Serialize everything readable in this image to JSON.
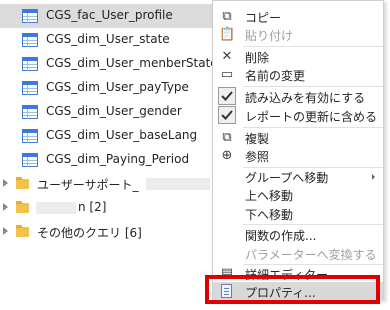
{
  "queries": [
    {
      "label": "CGS_fac_User_profile",
      "selected": true
    },
    {
      "label": "CGS_dim_User_state",
      "selected": false
    },
    {
      "label": "CGS_dim_User_menberState",
      "selected": false
    },
    {
      "label": "CGS_dim_User_payType",
      "selected": false
    },
    {
      "label": "CGS_dim_User_gender",
      "selected": false
    },
    {
      "label": "CGS_dim_User_baseLang",
      "selected": false
    },
    {
      "label": "CGS_dim_Paying_Period",
      "selected": false
    }
  ],
  "groups": [
    {
      "label": "ユーザーサポート_"
    },
    {
      "label": "n [2]"
    },
    {
      "label": "その他のクエリ [6]"
    }
  ],
  "menu": {
    "copy": "コピー",
    "paste": "貼り付け",
    "delete": "削除",
    "rename": "名前の変更",
    "enable_load": "読み込みを有効にする",
    "include_refresh": "レポートの更新に含める",
    "duplicate": "複製",
    "reference": "参照",
    "move_to_group": "グループへ移動",
    "move_up": "上へ移動",
    "move_down": "下へ移動",
    "create_function": "関数の作成...",
    "convert_to_parameter": "パラメーターへ変換する",
    "advanced_editor": "詳細エディター",
    "properties": "プロパティ..."
  },
  "colors": {
    "highlight_border": "#e00000",
    "selected_row": "#dcdcdc",
    "table_icon": "#3a7bd5",
    "folder": "#f2c24c"
  }
}
